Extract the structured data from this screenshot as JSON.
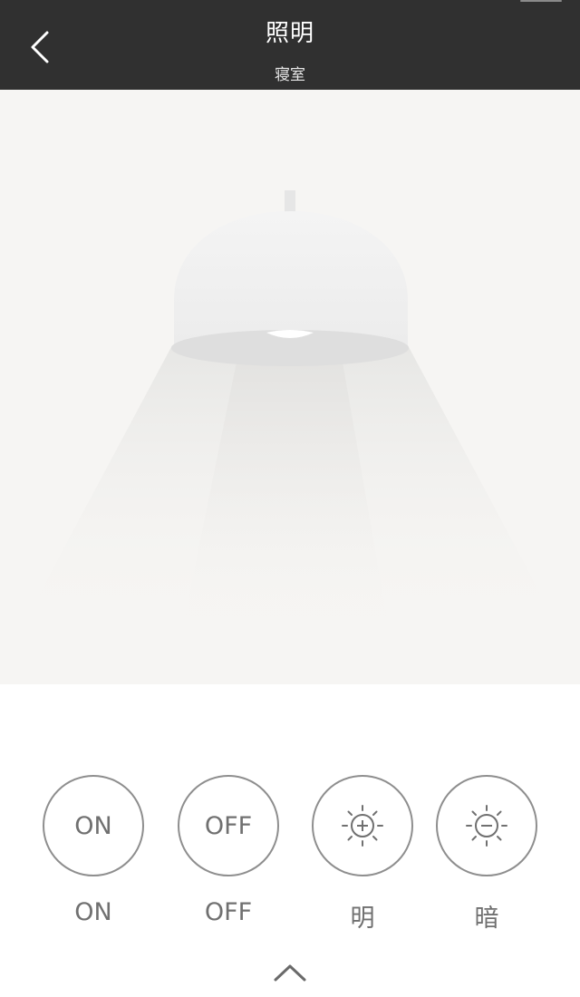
{
  "header": {
    "title": "照明",
    "subtitle": "寝室",
    "back_icon": "chevron-left-icon"
  },
  "illustration": {
    "subject": "pendant-lamp",
    "state": "off"
  },
  "controls": {
    "buttons": [
      {
        "id": "on",
        "button_text": "ON",
        "label": "ON"
      },
      {
        "id": "off",
        "button_text": "OFF",
        "label": "OFF"
      },
      {
        "id": "brighter",
        "icon": "sun-plus-icon",
        "label": "明"
      },
      {
        "id": "dimmer",
        "icon": "sun-minus-icon",
        "label": "暗"
      }
    ],
    "expand_icon": "chevron-up-icon"
  },
  "colors": {
    "header_bg": "#303030",
    "illustration_bg": "#f6f5f3",
    "control_stroke": "#8e8e8e",
    "control_text": "#707070"
  }
}
